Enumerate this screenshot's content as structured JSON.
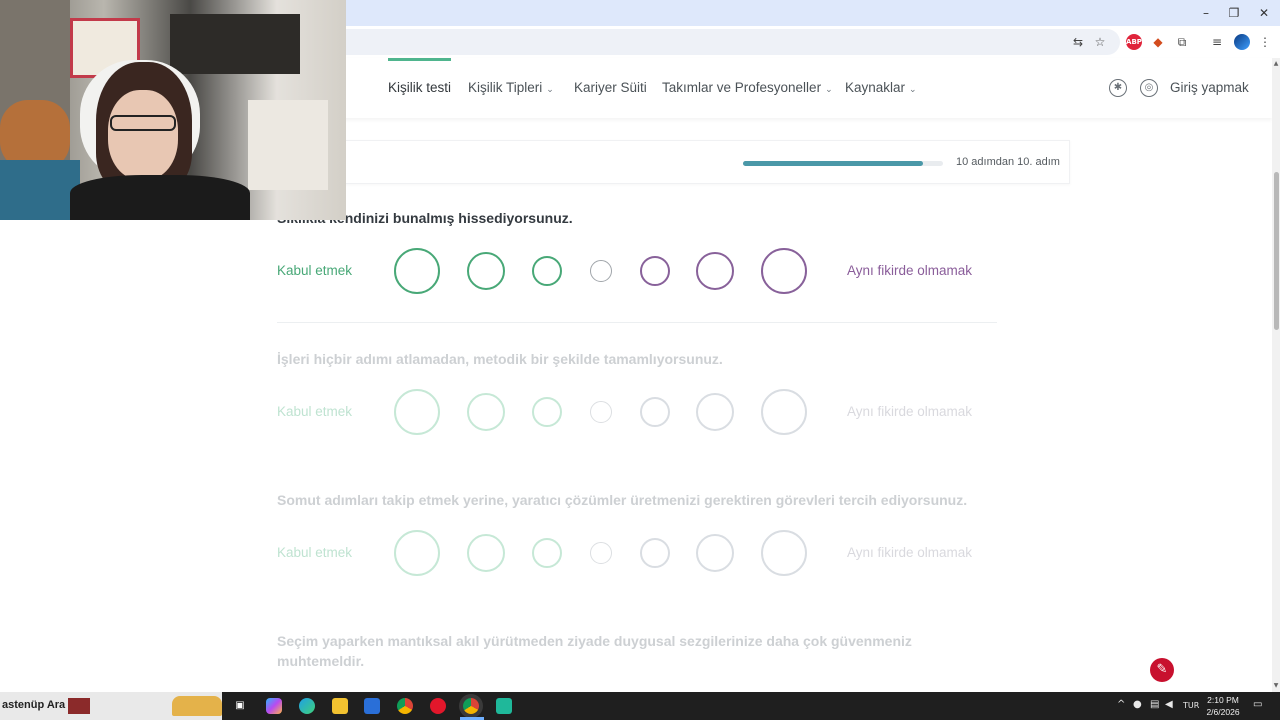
{
  "browser": {
    "window_controls": [
      "–",
      "❐",
      "✕"
    ],
    "extensions": [
      "translate-icon",
      "star-icon",
      "adblock-icon",
      "fox-extension-icon",
      "puzzle-icon",
      "media-icon",
      "profile-avatar",
      "menu-icon"
    ],
    "adblock_label": "ABP"
  },
  "nav": {
    "items": [
      {
        "label": "Kişilik testi",
        "dropdown": false,
        "active": true
      },
      {
        "label": "Kişilik Tipleri",
        "dropdown": true
      },
      {
        "label": "Kariyer Süiti",
        "dropdown": false
      },
      {
        "label": "Takımlar ve Profesyoneller",
        "dropdown": true
      },
      {
        "label": "Kaynaklar",
        "dropdown": true
      }
    ],
    "login_label": "Giriş yapmak"
  },
  "progress": {
    "fraction": 0.9,
    "label": "10 adımdan 10. adım"
  },
  "scale": {
    "agree_label": "Kabul etmek",
    "disagree_label": "Aynı fikirde olmamak",
    "options": 7,
    "colors": {
      "agree": "#48a877",
      "neutral": "#a0a5aa",
      "disagree": "#88619a",
      "agree_faded": "#c6e8d6",
      "neutral_faded": "#dcdfe2",
      "disagree_faded": "#d9dde2"
    }
  },
  "questions": [
    {
      "text": "Sıklıkla kendinizi bunalmış hissediyorsunuz.",
      "active": true
    },
    {
      "text": "İşleri hiçbir adımı atlamadan, metodik bir şekilde tamamlıyorsunuz.",
      "active": false
    },
    {
      "text": "Somut adımları takip etmek yerine, yaratıcı çözümler üretmenizi gerektiren görevleri tercih ediyorsunuz.",
      "active": false
    },
    {
      "text": "Seçim yaparken mantıksal akıl yürütmeden ziyade duygusal sezgilerinize daha çok güvenmeniz muhtemeldir.",
      "active": false
    }
  ],
  "taskbar": {
    "search_text": "astenüp Ara",
    "apps": [
      "task-view-icon",
      "copilot-icon",
      "edge-icon",
      "file-explorer-icon",
      "store-icon",
      "chrome-icon",
      "opera-icon",
      "chrome-active-icon",
      "app-icon"
    ],
    "tray_lang": "TUR",
    "time": "2:10 PM",
    "date": "2/6/2026"
  }
}
